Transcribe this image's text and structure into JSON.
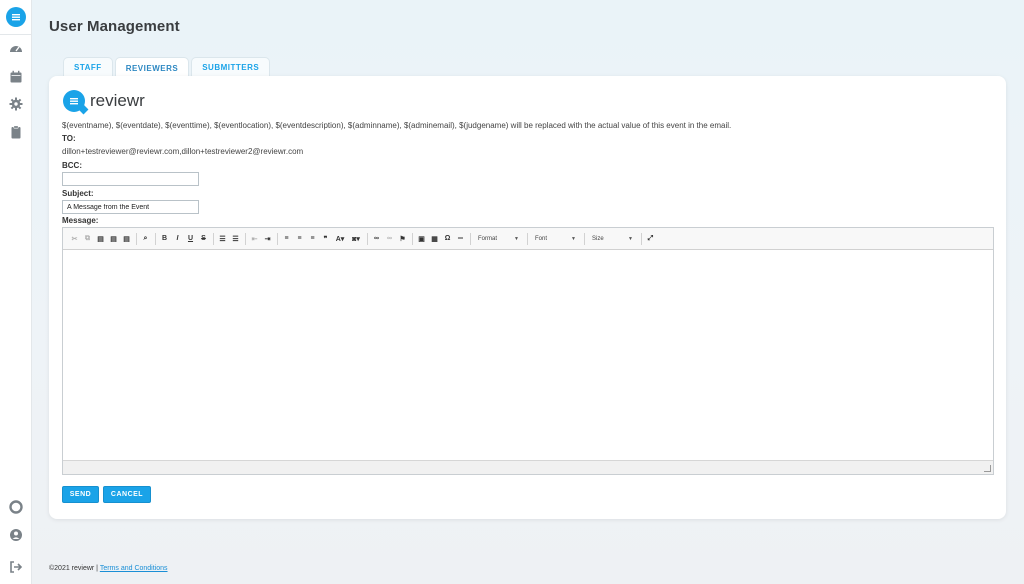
{
  "header": {
    "title": "User Management"
  },
  "tabs": [
    {
      "label": "STAFF"
    },
    {
      "label": "REVIEWERS"
    },
    {
      "label": "SUBMITTERS"
    }
  ],
  "brand": {
    "name": "reviewr"
  },
  "email": {
    "info": "$(eventname), $(eventdate), $(eventtime), $(eventlocation), $(eventdescription), $(adminname), $(adminemail), $(judgename) will be replaced with the actual value of this event in the email.",
    "to_label": "TO:",
    "to_value": "dillon+testreviewer@reviewr.com,dillon+testreviewer2@reviewr.com",
    "bcc_label": "BCC:",
    "bcc_value": "",
    "subject_label": "Subject:",
    "subject_value": "A Message from the Event",
    "message_label": "Message:"
  },
  "toolbar": {
    "format_label": "Format",
    "font_label": "Font",
    "size_label": "Size"
  },
  "actions": {
    "send_label": "SEND",
    "cancel_label": "CANCEL"
  },
  "footer": {
    "copyright": "©2021 reviewr |",
    "terms_label": "Terms and Conditions"
  },
  "colors": {
    "accent": "#1aa3e8",
    "title": "#3a3d40"
  }
}
